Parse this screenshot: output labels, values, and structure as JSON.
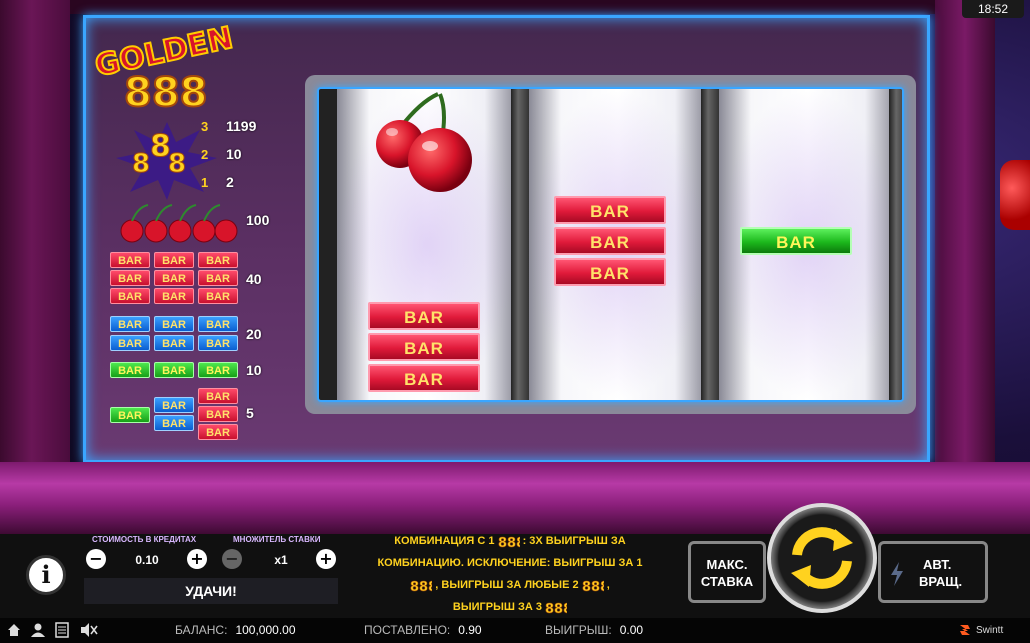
{
  "clock": "18:52",
  "logo": {
    "word": "GOLDEN",
    "number": "888"
  },
  "paytable": {
    "scatter_rows": [
      {
        "count": "3",
        "pay": "1199"
      },
      {
        "count": "2",
        "pay": "10"
      },
      {
        "count": "1",
        "pay": "2"
      }
    ],
    "cherry_pay": "100",
    "red_bar_pay": "40",
    "blue_bar_pay": "20",
    "green_bar_pay": "10",
    "any_bar_pay": "5",
    "bar_label": "BAR"
  },
  "reels": {
    "symbol_bar": "BAR",
    "reel1": [
      "cherry",
      "red-triple-bar"
    ],
    "reel2": [
      "red-triple-bar"
    ],
    "reel3": [
      "green-bar"
    ]
  },
  "controls": {
    "coin_value_label": "СТОИМОСТЬ В КРЕДИТАХ",
    "coin_value": "0.10",
    "multiplier_label": "МНОЖИТЕЛЬ СТАВКИ",
    "multiplier": "x1",
    "message": "УДАЧИ!",
    "rule_text_1": "КОМБИНАЦИЯ С 1",
    "rule_text_2": ": 3Х ВЫИГРЫШ ЗА",
    "rule_text_3": "КОМБИНАЦИЮ. ИСКЛЮЧЕНИЕ: ВЫИГРЫШ ЗА 1",
    "rule_text_4": ", ВЫИГРЫШ ЗА ЛЮБЫЕ 2",
    "rule_text_5": ",",
    "rule_text_6": "ВЫИГРЫШ ЗА 3",
    "max_bet_line1": "МАКС.",
    "max_bet_line2": "СТАВКА",
    "auto_line1": "АВТ.",
    "auto_line2": "ВРАЩ."
  },
  "status": {
    "balance_label": "БАЛАНС:",
    "balance": "100,000.00",
    "bet_label": "ПОСТАВЛЕНО:",
    "bet": "0.90",
    "win_label": "ВЫИГРЫШ:",
    "win": "0.00",
    "brand": "Swintt"
  },
  "colors": {
    "accent_gold": "#ffd21f",
    "neon_blue": "#3aa6ff",
    "red_bar": "#e01a3a",
    "green_bar": "#1cb81c",
    "blue_bar": "#0a5ed0"
  }
}
